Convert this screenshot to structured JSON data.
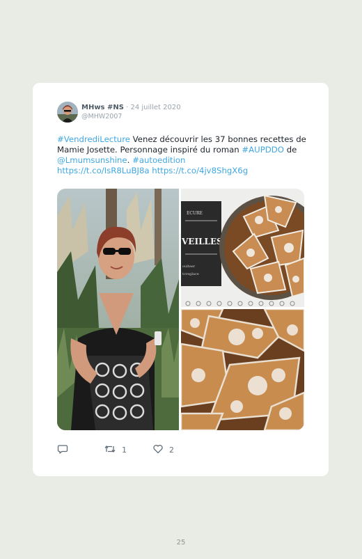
{
  "tweet": {
    "name": "MHws #NS",
    "date": "· 24 juillet 2020",
    "handle": "@MHW2007",
    "text": {
      "tag1": "#VendrediLecture",
      "seg1": " Venez découvrir les 37 bonnes recettes de Mamie Josette. Personnage inspiré du roman ",
      "tag2": "#AUPDDO",
      "seg2": " de ",
      "mention": "@Lmumsunshine",
      "seg3": ". ",
      "tag3": "#autoedition",
      "seg4": " ",
      "link1": "https://t.co/IsR8LuBJ8a",
      "seg5": " ",
      "link2": "https://t.co/4jv8ShgX6g"
    },
    "book_cover": {
      "line1": "ECURE",
      "line2": "VEILLES",
      "line3": "oulteer",
      "line4": "tcreglace"
    },
    "actions": {
      "retweets": "1",
      "likes": "2"
    }
  },
  "page_number": "25",
  "colors": {
    "background": "#e9ebe5",
    "link": "#3fa7e3"
  }
}
